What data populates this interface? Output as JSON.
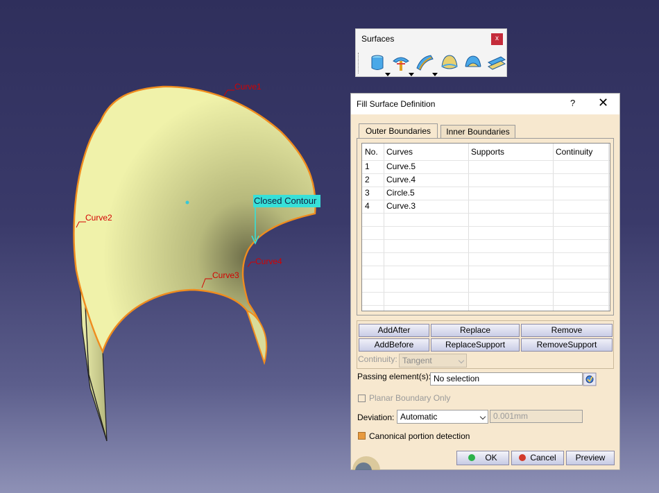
{
  "viewport": {
    "curve_labels": [
      "Curve1",
      "Curve2",
      "Curve3",
      "Curve4"
    ],
    "contour_label": "Closed Contour"
  },
  "toolbar": {
    "title": "Surfaces",
    "close_label": "x",
    "tools": [
      "extrude-icon",
      "revolve-icon",
      "sweep-icon",
      "fill-icon",
      "multi-section-icon",
      "blend-icon"
    ]
  },
  "dialog": {
    "title": "Fill Surface Definition",
    "help_label": "?",
    "close_label": "✕",
    "tabs": [
      "Outer Boundaries",
      "Inner Boundaries"
    ],
    "table": {
      "headers": [
        "No.",
        "Curves",
        "Supports",
        "Continuity"
      ],
      "rows": [
        {
          "no": "1",
          "curve": "Curve.5",
          "support": "",
          "continuity": ""
        },
        {
          "no": "2",
          "curve": "Curve.4",
          "support": "",
          "continuity": ""
        },
        {
          "no": "3",
          "curve": "Circle.5",
          "support": "",
          "continuity": ""
        },
        {
          "no": "4",
          "curve": "Curve.3",
          "support": "",
          "continuity": ""
        }
      ]
    },
    "buttons": {
      "add_after": "AddAfter",
      "replace": "Replace",
      "remove": "Remove",
      "add_before": "AddBefore",
      "replace_support": "ReplaceSupport",
      "remove_support": "RemoveSupport"
    },
    "continuity_label": "Continuity:",
    "continuity_value": "Tangent",
    "passing_label": "Passing element(s):",
    "passing_value": "No selection",
    "planar_label": "Planar Boundary Only",
    "deviation_label": "Deviation:",
    "deviation_mode": "Automatic",
    "deviation_value": "0.001mm",
    "canonical_label": "Canonical portion detection",
    "ok_label": "OK",
    "cancel_label": "Cancel",
    "preview_label": "Preview"
  },
  "colors": {
    "background_top": "#2f2f5c",
    "surface_fill": "#eef0a6",
    "edge_highlight": "#f08c1e",
    "label_red": "#d40000",
    "contour_cyan": "#37e0d8",
    "dialog_bg": "#f7e8cf"
  }
}
